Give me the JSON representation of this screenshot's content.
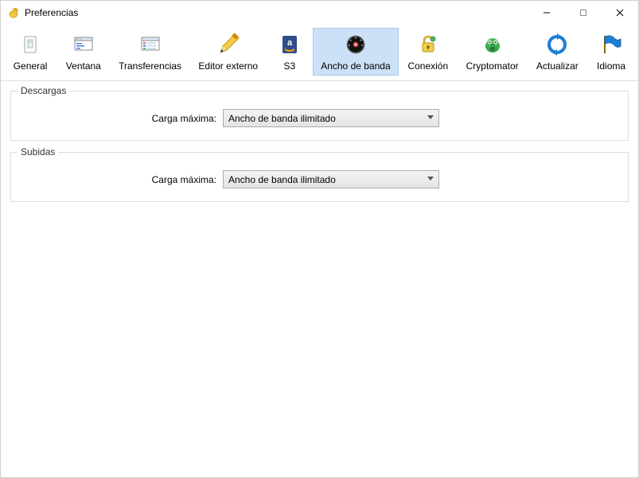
{
  "window": {
    "title": "Preferencias"
  },
  "toolbar": [
    {
      "id": "general",
      "label": "General",
      "selected": false
    },
    {
      "id": "ventana",
      "label": "Ventana",
      "selected": false
    },
    {
      "id": "transferencias",
      "label": "Transferencias",
      "selected": false
    },
    {
      "id": "editor",
      "label": "Editor externo",
      "selected": false
    },
    {
      "id": "s3",
      "label": "S3",
      "selected": false
    },
    {
      "id": "ancho",
      "label": "Ancho de banda",
      "selected": true
    },
    {
      "id": "conexion",
      "label": "Conexión",
      "selected": false
    },
    {
      "id": "cryptomator",
      "label": "Cryptomator",
      "selected": false
    },
    {
      "id": "actualizar",
      "label": "Actualizar",
      "selected": false
    },
    {
      "id": "idioma",
      "label": "Idioma",
      "selected": false
    }
  ],
  "groups": {
    "downloads": {
      "legend": "Descargas",
      "maxload_label": "Carga máxima:",
      "maxload_value": "Ancho de banda ilimitado"
    },
    "uploads": {
      "legend": "Subidas",
      "maxload_label": "Carga máxima:",
      "maxload_value": "Ancho de banda ilimitado"
    }
  }
}
